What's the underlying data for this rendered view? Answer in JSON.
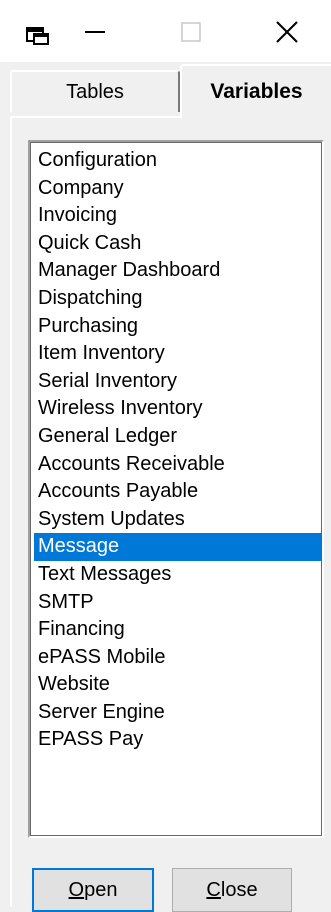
{
  "window": {
    "icon": "app-window-icon",
    "controls": [
      "minimize-icon",
      "maximize-icon",
      "close-icon"
    ]
  },
  "tabs": [
    {
      "label": "Tables",
      "selected": false
    },
    {
      "label": "Variables",
      "selected": true
    }
  ],
  "list": {
    "items": [
      "Configuration",
      "Company",
      "Invoicing",
      "Quick Cash",
      "Manager Dashboard",
      "Dispatching",
      "Purchasing",
      "Item Inventory",
      "Serial Inventory",
      "Wireless Inventory",
      "General Ledger",
      "Accounts Receivable",
      "Accounts Payable",
      "System Updates",
      "Message",
      "Text Messages",
      "SMTP",
      "Financing",
      "ePASS Mobile",
      "Website",
      "Server Engine",
      "EPASS Pay"
    ],
    "selected": "Message"
  },
  "buttons": {
    "open": {
      "accel": "O",
      "rest": "pen"
    },
    "close": {
      "accel": "C",
      "rest": "lose"
    }
  },
  "colors": {
    "selection": "#0078d7",
    "focus_border": "#0078d7",
    "window_bg": "#f0f0f0"
  }
}
